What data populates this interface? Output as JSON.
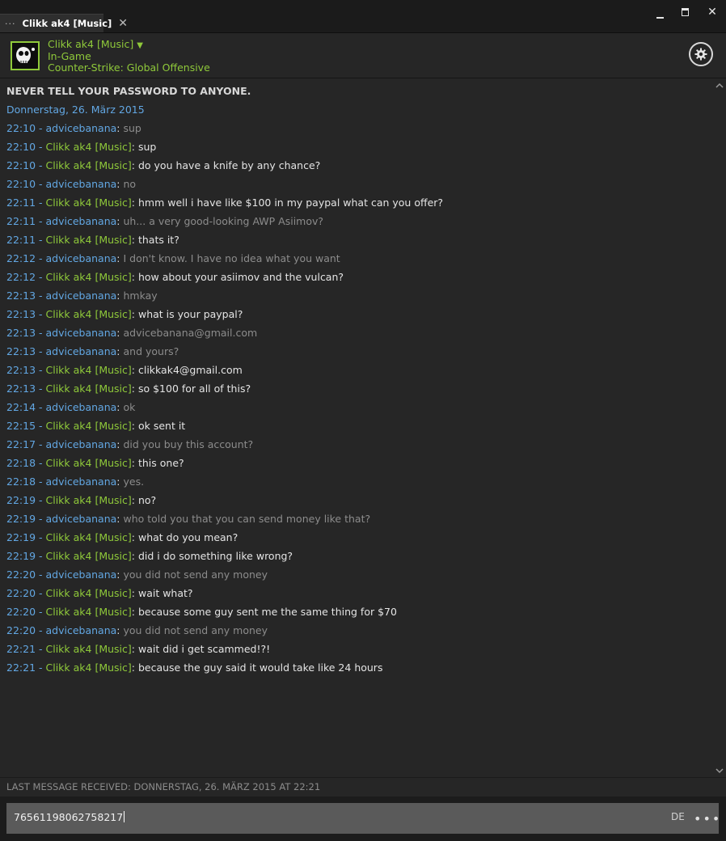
{
  "window": {
    "tab_title": "Clikk ak4 [Music]",
    "tab_dots": "···",
    "tab_close": "✕",
    "minimize": "▬",
    "maximize": "□",
    "close": "✕"
  },
  "friend": {
    "name": "Clikk ak4 [Music]",
    "status": "In-Game",
    "game": "Counter-Strike: Global Offensive"
  },
  "chat": {
    "warning": "NEVER TELL YOUR PASSWORD TO ANYONE.",
    "date_header": "Donnerstag, 26. März 2015",
    "messages": [
      {
        "time": "22:10",
        "name": "advicebanana",
        "self": false,
        "text": "sup"
      },
      {
        "time": "22:10",
        "name": "Clikk ak4 [Music]",
        "self": true,
        "text": "sup"
      },
      {
        "time": "22:10",
        "name": "Clikk ak4 [Music]",
        "self": true,
        "text": "do you have a knife by any chance?"
      },
      {
        "time": "22:10",
        "name": "advicebanana",
        "self": false,
        "text": "no"
      },
      {
        "time": "22:11",
        "name": "Clikk ak4 [Music]",
        "self": true,
        "text": "hmm well i have like $100 in my paypal what can you offer?"
      },
      {
        "time": "22:11",
        "name": "advicebanana",
        "self": false,
        "text": "uh... a very good-looking AWP Asiimov?"
      },
      {
        "time": "22:11",
        "name": "Clikk ak4 [Music]",
        "self": true,
        "text": "thats it?"
      },
      {
        "time": "22:12",
        "name": "advicebanana",
        "self": false,
        "text": "I don't know. I have no idea what you want"
      },
      {
        "time": "22:12",
        "name": "Clikk ak4 [Music]",
        "self": true,
        "text": "how about your asiimov and the vulcan?"
      },
      {
        "time": "22:13",
        "name": "advicebanana",
        "self": false,
        "text": "hmkay"
      },
      {
        "time": "22:13",
        "name": "Clikk ak4 [Music]",
        "self": true,
        "text": "what is your paypal?"
      },
      {
        "time": "22:13",
        "name": "advicebanana",
        "self": false,
        "text": "advicebanana@gmail.com"
      },
      {
        "time": "22:13",
        "name": "advicebanana",
        "self": false,
        "text": "and yours?"
      },
      {
        "time": "22:13",
        "name": "Clikk ak4 [Music]",
        "self": true,
        "text": "clikkak4@gmail.com"
      },
      {
        "time": "22:13",
        "name": "Clikk ak4 [Music]",
        "self": true,
        "text": "so $100 for all of this?"
      },
      {
        "time": "22:14",
        "name": "advicebanana",
        "self": false,
        "text": "ok"
      },
      {
        "time": "22:15",
        "name": "Clikk ak4 [Music]",
        "self": true,
        "text": "ok sent it"
      },
      {
        "time": "22:17",
        "name": "advicebanana",
        "self": false,
        "text": "did you buy this account?"
      },
      {
        "time": "22:18",
        "name": "Clikk ak4 [Music]",
        "self": true,
        "text": "this one?"
      },
      {
        "time": "22:18",
        "name": "advicebanana",
        "self": false,
        "text": "yes."
      },
      {
        "time": "22:19",
        "name": "Clikk ak4 [Music]",
        "self": true,
        "text": "no?"
      },
      {
        "time": "22:19",
        "name": "advicebanana",
        "self": false,
        "text": "who told you that you can send money like that?"
      },
      {
        "time": "22:19",
        "name": "Clikk ak4 [Music]",
        "self": true,
        "text": "what do you mean?"
      },
      {
        "time": "22:19",
        "name": "Clikk ak4 [Music]",
        "self": true,
        "text": "did i do something like wrong?"
      },
      {
        "time": "22:20",
        "name": "advicebanana",
        "self": false,
        "text": "you did not send any money"
      },
      {
        "time": "22:20",
        "name": "Clikk ak4 [Music]",
        "self": true,
        "text": "wait what?"
      },
      {
        "time": "22:20",
        "name": "Clikk ak4 [Music]",
        "self": true,
        "text": "because some guy sent me the same thing for $70"
      },
      {
        "time": "22:20",
        "name": "advicebanana",
        "self": false,
        "text": "you did not send any money"
      },
      {
        "time": "22:21",
        "name": "Clikk ak4 [Music]",
        "self": true,
        "text": "wait did i get scammed!?!"
      },
      {
        "time": "22:21",
        "name": "Clikk ak4 [Music]",
        "self": true,
        "text": "because the guy said it would take like 24 hours"
      }
    ],
    "last_message": "LAST MESSAGE RECEIVED: DONNERSTAG, 26. MÄRZ 2015 AT 22:21"
  },
  "input": {
    "value": "76561198062758217",
    "language": "DE",
    "more": "•••"
  },
  "colors": {
    "accent_green": "#8fc93a",
    "accent_blue": "#62a7e3",
    "background": "#262626"
  },
  "icons": {
    "settings": "gear-icon",
    "scroll_up": "chevron-up-icon",
    "scroll_down": "chevron-down-icon"
  }
}
